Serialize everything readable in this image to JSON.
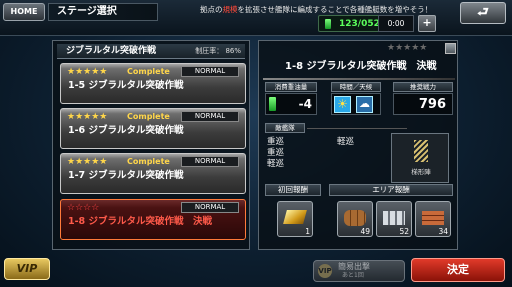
{
  "topbar": {
    "home_label": "HOME",
    "screen_title": "ステージ選択",
    "banner_pre": "拠点の",
    "banner_highlight": "規模",
    "banner_post": "を拡張させ艦隊に編成することで各種艦艇数を増やそう！",
    "fuel": "123/052",
    "timer": "0:00",
    "add_label": "+",
    "back_label": "⮐"
  },
  "stage_list": {
    "title": "ジブラルタル突破作戦",
    "rate_label": "制圧率：",
    "rate_value": "86%",
    "items": [
      {
        "stars": "★★★★★",
        "status": "Complete",
        "difficulty": "NORMAL",
        "name": "1-5 ジブラルタル突破作戦"
      },
      {
        "stars": "★★★★★",
        "status": "Complete",
        "difficulty": "NORMAL",
        "name": "1-6 ジブラルタル突破作戦"
      },
      {
        "stars": "★★★★★",
        "status": "Complete",
        "difficulty": "NORMAL",
        "name": "1-7 ジブラルタル突破作戦"
      },
      {
        "stars": "☆☆☆☆",
        "status": "",
        "difficulty": "NORMAL",
        "name": "1-8 ジブラルタル突破作戦　決戦"
      }
    ]
  },
  "detail": {
    "stars": "★★★★★",
    "stage_title": "1-8 ジブラルタル突破作戦　決戦",
    "fuel_label": "消費重油量",
    "fuel_value": "-4",
    "weather_label": "時間／天候",
    "power_label": "推奨戦力",
    "power_value": "796",
    "fleet_label": "敵艦隊",
    "ships_col1": [
      "重巡",
      "重巡",
      "軽巡"
    ],
    "ships_col2": [
      "軽巡"
    ],
    "formation": "梯形陣",
    "first_reward_label": "初回報酬",
    "area_reward_label": "エリア報酬",
    "rewards": [
      {
        "icon": "gold-bar-icon",
        "count": "1"
      },
      {
        "icon": "wood-icon",
        "count": "49"
      },
      {
        "icon": "steel-icon",
        "count": "52"
      },
      {
        "icon": "brick-icon",
        "count": "34"
      }
    ]
  },
  "footer": {
    "vip_label": "VIP",
    "simple_icon": "VIP",
    "simple_label": "簡易出撃",
    "simple_sub": "あと1回",
    "decide_label": "決定"
  },
  "colors": {
    "accent_red": "#e23a2a",
    "star_gold": "#ffd64a",
    "fuel_green": "#5cff5c"
  }
}
